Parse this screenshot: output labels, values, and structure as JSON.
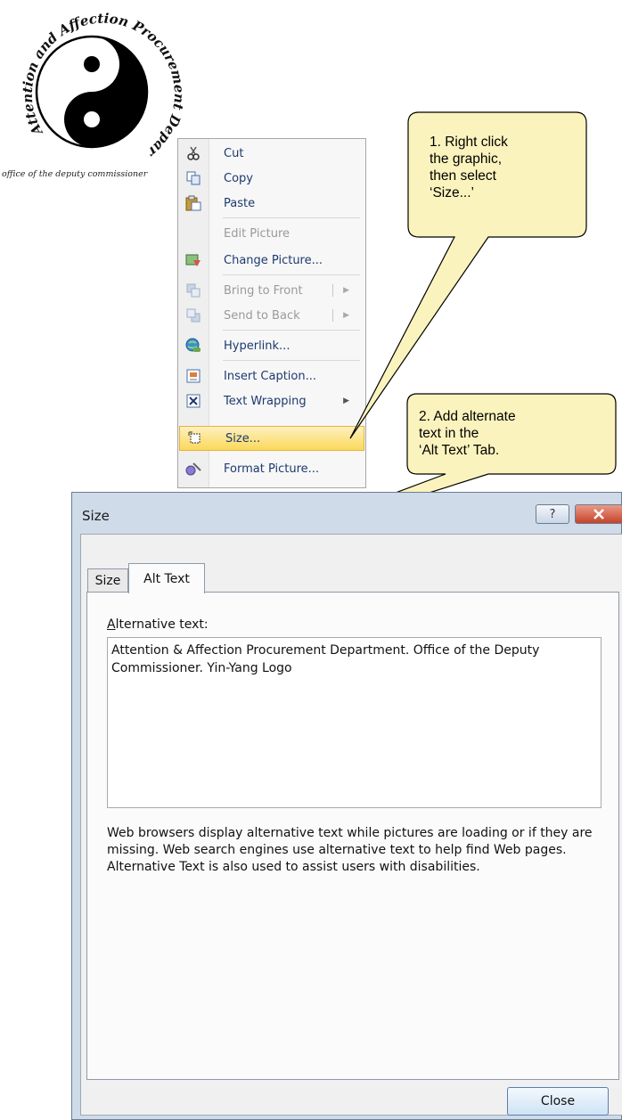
{
  "logo": {
    "name_arc": "Attention and Affection Procurement Department",
    "caption": "office of the deputy commissioner"
  },
  "context_menu": {
    "items": [
      {
        "label": "Cut",
        "icon": "scissors-icon",
        "enabled": true
      },
      {
        "label": "Copy",
        "icon": "copy-icon",
        "enabled": true
      },
      {
        "label": "Paste",
        "icon": "paste-icon",
        "enabled": true
      },
      {
        "label": "Edit Picture",
        "icon": "",
        "enabled": false
      },
      {
        "label": "Change Picture...",
        "icon": "change-picture-icon",
        "enabled": true
      },
      {
        "label": "Bring to Front",
        "icon": "bring-to-front-icon",
        "enabled": false
      },
      {
        "label": "Send to Back",
        "icon": "send-to-back-icon",
        "enabled": false
      },
      {
        "label": "Hyperlink...",
        "icon": "hyperlink-icon",
        "enabled": true
      },
      {
        "label": "Insert Caption...",
        "icon": "insert-caption-icon",
        "enabled": true
      },
      {
        "label": "Text Wrapping",
        "icon": "text-wrapping-icon",
        "enabled": true
      },
      {
        "label": "Size...",
        "icon": "size-icon",
        "enabled": true,
        "highlighted": true
      },
      {
        "label": "Format Picture...",
        "icon": "format-picture-icon",
        "enabled": true
      }
    ]
  },
  "callouts": {
    "step1": {
      "lines": [
        "1. Right click",
        "the graphic,",
        "then select",
        "‘Size...’"
      ]
    },
    "step2": {
      "lines": [
        "2. Add alternate",
        "text in the",
        "‘Alt Text’ Tab."
      ]
    }
  },
  "dialog": {
    "title": "Size",
    "help_button": "?",
    "tabs": [
      "Size",
      "Alt Text"
    ],
    "active_tab": "Alt Text",
    "alt_label": "Alternative text:",
    "alt_text_value": "Attention & Affection Procurement Department. Office of the Deputy Commissioner. Yin-Yang Logo",
    "help_text": "Web browsers display alternative text while pictures are loading or if they are missing.  Web search engines use alternative text to help find Web pages.  Alternative Text is also used to assist users with disabilities.",
    "close_button": "Close"
  },
  "colors": {
    "callout_fill": "#fbf3bd",
    "menu_highlight": "#fbd85a",
    "dialog_frame": "#cfdbe8",
    "close_x": "#c5432a"
  }
}
